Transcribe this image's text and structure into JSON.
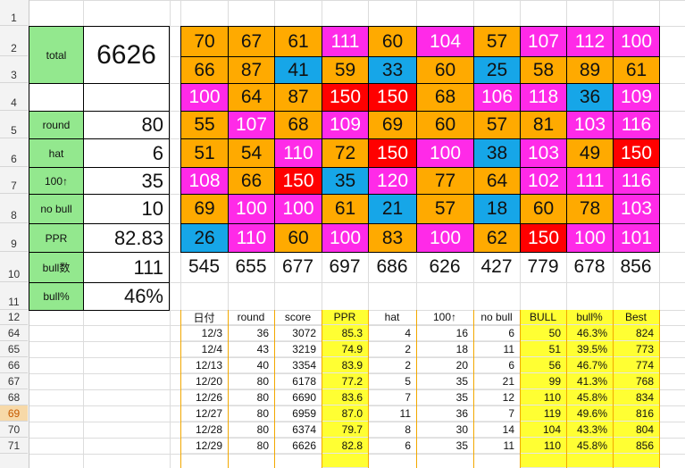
{
  "row_headers": [
    "1",
    "2",
    "3",
    "4",
    "5",
    "6",
    "7",
    "8",
    "9",
    "10",
    "11",
    "12",
    "64",
    "65",
    "66",
    "67",
    "68",
    "69",
    "70",
    "71"
  ],
  "selected_row": "69",
  "stats": {
    "total_label": "total",
    "total_value": "6626",
    "round_label": "round",
    "round_value": "80",
    "hat_label": "hat",
    "hat_value": "6",
    "ton_label": "100↑",
    "ton_value": "35",
    "nobull_label": "no bull",
    "nobull_value": "10",
    "ppr_label": "PPR",
    "ppr_value": "82.83",
    "bullcount_label": "bull数",
    "bullcount_value": "111",
    "bullpct_label": "bull%",
    "bullpct_value": "46%"
  },
  "colors": {
    "orange": "#ffaa00",
    "magenta": "#ff2ae8",
    "blue": "#16a6e8",
    "red": "#ff0000",
    "green": "#93e88e",
    "yellow": "#ffff33"
  },
  "score_grid": [
    [
      [
        "70",
        "orange"
      ],
      [
        "67",
        "orange"
      ],
      [
        "61",
        "orange"
      ],
      [
        "111",
        "magenta"
      ],
      [
        "60",
        "orange"
      ],
      [
        "104",
        "magenta"
      ],
      [
        "57",
        "orange"
      ],
      [
        "107",
        "magenta"
      ],
      [
        "112",
        "magenta"
      ],
      [
        "100",
        "magenta"
      ]
    ],
    [
      [
        "66",
        "orange"
      ],
      [
        "87",
        "orange"
      ],
      [
        "41",
        "blue"
      ],
      [
        "59",
        "orange"
      ],
      [
        "33",
        "blue"
      ],
      [
        "60",
        "orange"
      ],
      [
        "25",
        "blue"
      ],
      [
        "58",
        "orange"
      ],
      [
        "89",
        "orange"
      ],
      [
        "61",
        "orange"
      ]
    ],
    [
      [
        "100",
        "magenta"
      ],
      [
        "64",
        "orange"
      ],
      [
        "87",
        "orange"
      ],
      [
        "150",
        "red"
      ],
      [
        "150",
        "red"
      ],
      [
        "68",
        "orange"
      ],
      [
        "106",
        "magenta"
      ],
      [
        "118",
        "magenta"
      ],
      [
        "36",
        "blue"
      ],
      [
        "109",
        "magenta"
      ]
    ],
    [
      [
        "55",
        "orange"
      ],
      [
        "107",
        "magenta"
      ],
      [
        "68",
        "orange"
      ],
      [
        "109",
        "magenta"
      ],
      [
        "69",
        "orange"
      ],
      [
        "60",
        "orange"
      ],
      [
        "57",
        "orange"
      ],
      [
        "81",
        "orange"
      ],
      [
        "103",
        "magenta"
      ],
      [
        "116",
        "magenta"
      ]
    ],
    [
      [
        "51",
        "orange"
      ],
      [
        "54",
        "orange"
      ],
      [
        "110",
        "magenta"
      ],
      [
        "72",
        "orange"
      ],
      [
        "150",
        "red"
      ],
      [
        "100",
        "magenta"
      ],
      [
        "38",
        "blue"
      ],
      [
        "103",
        "magenta"
      ],
      [
        "49",
        "orange"
      ],
      [
        "150",
        "red"
      ]
    ],
    [
      [
        "108",
        "magenta"
      ],
      [
        "66",
        "orange"
      ],
      [
        "150",
        "red"
      ],
      [
        "35",
        "blue"
      ],
      [
        "120",
        "magenta"
      ],
      [
        "77",
        "orange"
      ],
      [
        "64",
        "orange"
      ],
      [
        "102",
        "magenta"
      ],
      [
        "111",
        "magenta"
      ],
      [
        "116",
        "magenta"
      ]
    ],
    [
      [
        "69",
        "orange"
      ],
      [
        "100",
        "magenta"
      ],
      [
        "100",
        "magenta"
      ],
      [
        "61",
        "orange"
      ],
      [
        "21",
        "blue"
      ],
      [
        "57",
        "orange"
      ],
      [
        "18",
        "blue"
      ],
      [
        "60",
        "orange"
      ],
      [
        "78",
        "orange"
      ],
      [
        "103",
        "magenta"
      ]
    ],
    [
      [
        "26",
        "blue"
      ],
      [
        "110",
        "magenta"
      ],
      [
        "60",
        "orange"
      ],
      [
        "100",
        "magenta"
      ],
      [
        "83",
        "orange"
      ],
      [
        "100",
        "magenta"
      ],
      [
        "62",
        "orange"
      ],
      [
        "150",
        "red"
      ],
      [
        "100",
        "magenta"
      ],
      [
        "101",
        "magenta"
      ]
    ]
  ],
  "column_sums": [
    "545",
    "655",
    "677",
    "697",
    "686",
    "626",
    "427",
    "779",
    "678",
    "856"
  ],
  "history": {
    "headers": [
      "日付",
      "round",
      "score",
      "PPR",
      "hat",
      "100↑",
      "no bull",
      "BULL",
      "bull%",
      "Best"
    ],
    "rows": [
      [
        "12/3",
        "36",
        "3072",
        "85.3",
        "4",
        "16",
        "6",
        "50",
        "46.3%",
        "824"
      ],
      [
        "12/4",
        "43",
        "3219",
        "74.9",
        "2",
        "18",
        "11",
        "51",
        "39.5%",
        "773"
      ],
      [
        "12/13",
        "40",
        "3354",
        "83.9",
        "2",
        "20",
        "6",
        "56",
        "46.7%",
        "774"
      ],
      [
        "12/20",
        "80",
        "6178",
        "77.2",
        "5",
        "35",
        "21",
        "99",
        "41.3%",
        "768"
      ],
      [
        "12/26",
        "80",
        "6690",
        "83.6",
        "7",
        "35",
        "12",
        "110",
        "45.8%",
        "834"
      ],
      [
        "12/27",
        "80",
        "6959",
        "87.0",
        "11",
        "36",
        "7",
        "119",
        "49.6%",
        "816"
      ],
      [
        "12/28",
        "80",
        "6374",
        "79.7",
        "8",
        "30",
        "14",
        "104",
        "43.3%",
        "804"
      ],
      [
        "12/29",
        "80",
        "6626",
        "82.8",
        "6",
        "35",
        "11",
        "110",
        "45.8%",
        "856"
      ]
    ]
  }
}
